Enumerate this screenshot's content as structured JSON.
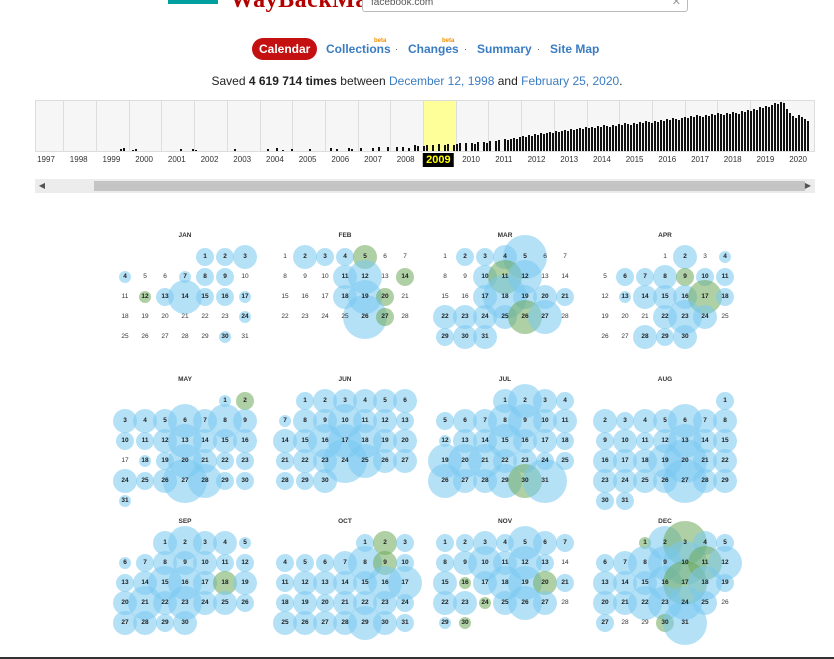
{
  "header": {
    "logo_text": "WayBackMachine",
    "url_value": "facebook.com",
    "clear_icon": "close-icon"
  },
  "nav": {
    "items": [
      {
        "label": "Calendar",
        "active": true
      },
      {
        "label": "Collections",
        "beta": "beta"
      },
      {
        "label": "Changes",
        "beta": "beta"
      },
      {
        "label": "Summary"
      },
      {
        "label": "Site Map"
      }
    ],
    "separator": "·"
  },
  "saved": {
    "prefix": "Saved",
    "count": "4 619 714 times",
    "between": "between",
    "start": "December 12, 1998",
    "and": "and",
    "end": "February 25, 2020",
    "period": "."
  },
  "timeline": {
    "years": [
      "1997",
      "1998",
      "1999",
      "2000",
      "2001",
      "2002",
      "2003",
      "2004",
      "2005",
      "2006",
      "2007",
      "2008",
      "2009",
      "2010",
      "2011",
      "2012",
      "2013",
      "2014",
      "2015",
      "2016",
      "2017",
      "2018",
      "2019",
      "2020"
    ],
    "selected_year": "2009",
    "highlight_color": "#ffff99"
  },
  "scrollbar": {
    "left_icon": "chevron-left-icon",
    "right_icon": "chevron-right-icon"
  },
  "calendar": {
    "year": "2009",
    "months": [
      {
        "name": "JAN",
        "first_weekday": 4,
        "days": 31,
        "captures": {
          "1": "b2",
          "2": "b2",
          "3": "b3",
          "4": "b1",
          "7": "b1",
          "8": "b2",
          "9": "b2",
          "12": "g1",
          "13": "b2",
          "14": "b4",
          "15": "b2",
          "16": "b2",
          "17": "b1",
          "24": "b1",
          "30": "b1"
        }
      },
      {
        "name": "FEB",
        "first_weekday": 0,
        "days": 28,
        "captures": {
          "2": "b3",
          "3": "b2",
          "4": "b2",
          "5": "g3",
          "11": "b3",
          "12": "b4",
          "14": "g2",
          "18": "b3",
          "19": "b4",
          "20": "g2",
          "26": "b5",
          "27": "g2"
        }
      },
      {
        "name": "MAR",
        "first_weekday": 0,
        "days": 31,
        "captures": {
          "2": "b2",
          "3": "b2",
          "4": "b3",
          "5": "b5",
          "10": "b3",
          "11": "g4",
          "12": "b4",
          "17": "b3",
          "18": "b5",
          "19": "b3",
          "20": "b3",
          "21": "b2",
          "22": "b3",
          "23": "b3",
          "24": "b3",
          "25": "b3",
          "26": "g4",
          "27": "b4",
          "29": "b2",
          "30": "b3",
          "31": "b3"
        }
      },
      {
        "name": "APR",
        "first_weekday": 3,
        "days": 30,
        "captures": {
          "2": "b3",
          "4": "b1",
          "6": "b2",
          "7": "b2",
          "8": "b3",
          "9": "g2",
          "10": "b2",
          "11": "b2",
          "13": "b1",
          "14": "b3",
          "15": "b3",
          "16": "b3",
          "17": "g4",
          "18": "b2",
          "22": "b3",
          "23": "b4",
          "24": "b3",
          "28": "b3",
          "29": "b2",
          "30": "b3"
        }
      },
      {
        "name": "MAY",
        "first_weekday": 5,
        "days": 31,
        "captures": {
          "1": "b1",
          "2": "g2",
          "3": "b3",
          "4": "b3",
          "5": "b3",
          "6": "b4",
          "7": "b3",
          "8": "b4",
          "9": "b3",
          "10": "b2",
          "11": "b2",
          "12": "b3",
          "13": "b4",
          "14": "b3",
          "15": "b3",
          "16": "b3",
          "18": "b1",
          "19": "b2",
          "20": "b4",
          "21": "b3",
          "22": "b2",
          "23": "b2",
          "24": "b3",
          "25": "b2",
          "26": "b3",
          "27": "b5",
          "28": "b4",
          "29": "b2",
          "30": "b2",
          "31": "b1"
        }
      },
      {
        "name": "JUN",
        "first_weekday": 1,
        "days": 30,
        "captures": {
          "1": "b2",
          "2": "b3",
          "3": "b3",
          "4": "b3",
          "5": "b3",
          "6": "b3",
          "7": "b1",
          "8": "b3",
          "9": "b3",
          "10": "b4",
          "11": "b3",
          "12": "b3",
          "13": "b2",
          "14": "b3",
          "15": "b3",
          "16": "b4",
          "17": "b4",
          "18": "b4",
          "19": "b3",
          "20": "b3",
          "21": "b2",
          "22": "b3",
          "23": "b3",
          "24": "b5",
          "25": "b4",
          "26": "b3",
          "27": "b3",
          "28": "b2",
          "29": "b2",
          "30": "b3"
        }
      },
      {
        "name": "JUL",
        "first_weekday": 3,
        "days": 31,
        "captures": {
          "1": "b3",
          "2": "b4",
          "3": "b3",
          "4": "b2",
          "5": "b2",
          "6": "b3",
          "7": "b3",
          "8": "b4",
          "9": "b4",
          "10": "b3",
          "11": "b3",
          "12": "b1",
          "13": "b3",
          "14": "b3",
          "15": "b4",
          "16": "b3",
          "17": "b3",
          "18": "b2",
          "19": "b4",
          "20": "b4",
          "21": "b4",
          "22": "b3",
          "23": "b3",
          "24": "b2",
          "25": "b2",
          "26": "b4",
          "27": "b3",
          "28": "b3",
          "29": "b4",
          "30": "g4",
          "31": "b5"
        }
      },
      {
        "name": "AUG",
        "first_weekday": 6,
        "days": 31,
        "captures": {
          "1": "b2",
          "2": "b3",
          "3": "b2",
          "4": "b3",
          "5": "b3",
          "6": "b4",
          "7": "b3",
          "8": "b3",
          "9": "b2",
          "10": "b3",
          "11": "b2",
          "12": "b3",
          "13": "b4",
          "14": "b3",
          "15": "b3",
          "16": "b3",
          "17": "b3",
          "18": "b3",
          "19": "b4",
          "20": "b5",
          "21": "b3",
          "22": "b3",
          "23": "b3",
          "24": "b3",
          "25": "b3",
          "26": "b3",
          "27": "b5",
          "28": "b3",
          "29": "b3",
          "30": "b2",
          "31": "b2"
        }
      },
      {
        "name": "SEP",
        "first_weekday": 2,
        "days": 30,
        "captures": {
          "1": "b3",
          "2": "b4",
          "3": "b3",
          "4": "b3",
          "5": "b1",
          "6": "b1",
          "7": "b2",
          "8": "b3",
          "9": "b3",
          "10": "b3",
          "11": "b2",
          "12": "b2",
          "13": "b2",
          "14": "b3",
          "15": "b4",
          "16": "b4",
          "17": "b3",
          "18": "g3",
          "19": "b3",
          "20": "b3",
          "21": "b4",
          "22": "b3",
          "23": "b4",
          "24": "b3",
          "25": "b3",
          "26": "b2",
          "27": "b3",
          "28": "b3",
          "29": "b2",
          "30": "b3"
        }
      },
      {
        "name": "OCT",
        "first_weekday": 4,
        "days": 31,
        "captures": {
          "1": "b2",
          "2": "g3",
          "3": "b2",
          "4": "b2",
          "5": "b2",
          "6": "b2",
          "7": "b3",
          "8": "b4",
          "9": "g3",
          "10": "b2",
          "11": "b2",
          "12": "b3",
          "13": "b3",
          "14": "b3",
          "15": "b3",
          "16": "b4",
          "17": "b4",
          "18": "b2",
          "19": "b3",
          "20": "b2",
          "21": "b3",
          "22": "b3",
          "23": "b3",
          "24": "b2",
          "25": "b3",
          "26": "b3",
          "27": "b3",
          "28": "b3",
          "29": "b4",
          "30": "b3",
          "31": "b2"
        }
      },
      {
        "name": "NOV",
        "first_weekday": 0,
        "days": 30,
        "captures": {
          "1": "b2",
          "2": "b2",
          "3": "b3",
          "4": "b2",
          "5": "b4",
          "6": "b3",
          "7": "b2",
          "8": "b2",
          "9": "b3",
          "10": "b4",
          "11": "b3",
          "12": "b4",
          "13": "b2",
          "15": "b3",
          "16": "g1",
          "17": "b3",
          "18": "b4",
          "19": "b4",
          "20": "g3",
          "21": "b2",
          "22": "b3",
          "23": "b3",
          "24": "g1",
          "25": "b3",
          "26": "b4",
          "27": "b3",
          "29": "b1",
          "30": "g1"
        }
      },
      {
        "name": "DEC",
        "first_weekday": 2,
        "days": 31,
        "captures": {
          "1": "g1",
          "2": "b4",
          "3": "g5",
          "4": "b3",
          "5": "b2",
          "6": "b2",
          "7": "b3",
          "8": "b4",
          "9": "b4",
          "10": "b5",
          "11": "g4",
          "12": "b4",
          "13": "b3",
          "14": "b3",
          "15": "b3",
          "16": "b4",
          "17": "g5",
          "18": "b4",
          "19": "b2",
          "20": "b3",
          "21": "b3",
          "22": "b4",
          "23": "b4",
          "24": "b4",
          "25": "b3",
          "27": "b2",
          "30": "g2",
          "31": "b5"
        }
      }
    ]
  }
}
